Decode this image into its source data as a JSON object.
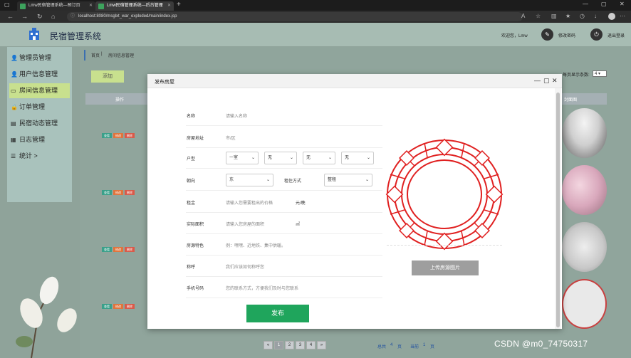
{
  "browser": {
    "tabs": [
      {
        "title": "Lmw民宿管理系统—预订页",
        "active": false
      },
      {
        "title": "Lmw民宿管理系统—后台管理",
        "active": true
      }
    ],
    "url": "localhost:8080/msglxt_war_exploded/main/index.jsp"
  },
  "header": {
    "title": "民宿管理系统",
    "welcome": "欢迎您，Lmw",
    "change_password": "修改密码",
    "logout": "退出登录"
  },
  "sidebar": {
    "items": [
      {
        "label": "管理员管理",
        "icon": "user-icon"
      },
      {
        "label": "用户信息管理",
        "icon": "user-icon"
      },
      {
        "label": "房间信息管理",
        "icon": "bed-icon",
        "active": true
      },
      {
        "label": "订单管理",
        "icon": "lock-icon"
      },
      {
        "label": "民宿动态管理",
        "icon": "news-icon"
      },
      {
        "label": "日志管理",
        "icon": "calendar-icon"
      },
      {
        "label": "统计 >",
        "icon": "list-icon"
      }
    ]
  },
  "breadcrumb": {
    "home": "首页",
    "current": "房间信息管理"
  },
  "toolbar": {
    "add_label": "添加",
    "per_page_label": "每页显示条数:",
    "per_page_value": "4"
  },
  "table": {
    "headers": [
      "操作",
      "封面图"
    ],
    "actions": [
      "查看",
      "修改",
      "删除"
    ]
  },
  "pagination": {
    "prev": "«",
    "pages": [
      "1",
      "2",
      "3",
      "4"
    ],
    "current": "1",
    "next": "»",
    "total_prefix": "总共",
    "total_pages": "4",
    "total_suffix": "页",
    "current_prefix": "当前",
    "current_page": "1",
    "current_suffix": "页"
  },
  "modal": {
    "title": "发布房屋",
    "fields": {
      "name": {
        "label": "名称",
        "placeholder": "请输入名称"
      },
      "address": {
        "label": "房屋地址",
        "value": "市/区"
      },
      "layout": {
        "label": "户型",
        "options": [
          "一室",
          "无",
          "无",
          "无"
        ]
      },
      "orientation": {
        "label": "朝向",
        "value": "东"
      },
      "rent_type": {
        "label": "租住方式",
        "value": "整租"
      },
      "rent": {
        "label": "租金",
        "placeholder": "请输入您需要租出的价格",
        "unit": "元/晚"
      },
      "area": {
        "label": "实际面积",
        "placeholder": "请输入您房屋的面积",
        "unit": "㎡"
      },
      "features": {
        "label": "房源特色",
        "placeholder": "例：嘿嘿、近地铁、集中供暖。"
      },
      "nickname": {
        "label": "称呼",
        "placeholder": "我们应该如何称呼您"
      },
      "phone": {
        "label": "手机号码",
        "placeholder": "您的联系方式，方便我们及时与您联系"
      }
    },
    "publish_label": "发布",
    "upload_label": "上传房源图片"
  },
  "watermark": "CSDN @m0_74750317",
  "colors": {
    "accent_green": "#1fa55c",
    "sidebar_active": "#c8e08e",
    "header_bg": "#a7bcb3",
    "lattice_red": "#e02020"
  }
}
